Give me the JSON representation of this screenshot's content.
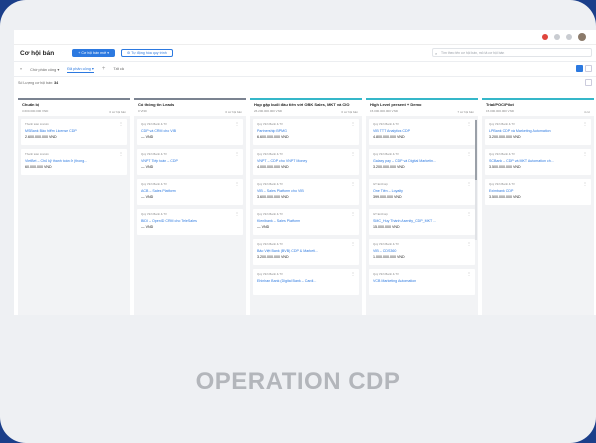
{
  "header": {
    "title": "Cơ hội bán",
    "add_button": "+ Cơ hội bán mới ▾",
    "auto_button": "Tự động hóa quy trình",
    "search_placeholder": "Tìm theo tên cơ hội bán, mô tả cơ hội bán"
  },
  "tabs": [
    {
      "label": "Chờ phân công ▾"
    },
    {
      "label": "Đã phân công ▾"
    },
    {
      "label": "Tất cả"
    }
  ],
  "count_label": "Số Lượng cơ hội bán:",
  "count_value": "34",
  "columns": [
    {
      "title": "Chuẩn bị",
      "sum": "3.600.000.000 VND",
      "count": "0 cơ hội bán",
      "color": "#7b8391",
      "cards": [
        {
          "company": "Thanh toán Lincoln",
          "name": "MSBank Bảo hiểm License CDP",
          "value": "2.600.000.000 VND"
        },
        {
          "company": "Thanh toán Lincoln",
          "name": "VietBet – Chủ kỹ thanh toán ở (thong...",
          "value": "60.000.000 VND"
        }
      ]
    },
    {
      "title": "Có thông tin Leads",
      "sum": "0 VND",
      "count": "0 cơ hội bán",
      "color": "#7b8391",
      "cards": [
        {
          "company": "Quý Vĩnh Banh & TV",
          "name": "CDP và CRM cho VIB",
          "value": "— VND"
        },
        {
          "company": "Quý Vĩnh Banh & TV",
          "name": "VNPT Tiếp toàn – CDP",
          "value": "— VND"
        },
        {
          "company": "Quý Vĩnh Banh & TV",
          "name": "ACB – Sales Platform",
          "value": "— VND"
        },
        {
          "company": "Quý Vĩnh Banh & TV",
          "name": "BIDI – OpenID CRM cho TeleSales",
          "value": "— VND"
        }
      ]
    },
    {
      "title": "Họp gặp buổi đầu tiên với OBK Sales, MKT và CIO",
      "sum": "26.200.000.000 VND",
      "count": "0 cơ hội bán",
      "color": "#35b7c9",
      "cards": [
        {
          "company": "Quý Vĩnh Banh & TV",
          "name": "Partnership BPMG",
          "value": "6.600.000.000 VND"
        },
        {
          "company": "Quý Vĩnh Banh & TV",
          "name": "VNPT – CDP cho VNPT Money",
          "value": "4.000.000.000 VND"
        },
        {
          "company": "Quý Vĩnh Banh & TV",
          "name": "VIB – Sales Platform cho VIB",
          "value": "3.600.000.000 VND"
        },
        {
          "company": "Quý Vĩnh Banh & TV",
          "name": "Kienlbank – Sales Platform",
          "value": "— VND"
        },
        {
          "company": "Quý Vĩnh Banh & TV",
          "name": "Bảo Việt Bank (BVB) CDP & Marketi...",
          "value": "3.200.000.000 VND"
        },
        {
          "company": "Quý Vĩnh Banh & TV",
          "name": "Ehinhan Bank (Digital Bank – Cardi...",
          "value": ""
        }
      ]
    },
    {
      "title": "High Level present + Demo",
      "sum": "15.000.000.000 VND",
      "count": "7 cơ hội bán",
      "color": "#35b7c9",
      "cards": [
        {
          "company": "Quý Vĩnh Banh & TV",
          "name": "VIB TTT Analytics CDP",
          "value": "4.800.000.000 VND"
        },
        {
          "company": "Quý Vĩnh Banh & TV",
          "name": "Galaxy pay – CDP và Digital Marketin...",
          "value": "3.200.000.000 VND"
        },
        {
          "company": "GT EntCorp",
          "name": "One Tiên – Loyalty",
          "value": "399.000.000 VND"
        },
        {
          "company": "GT EntCorp",
          "name": "SMC_Huy Thành Asenity_CDP_MKT ...",
          "value": "15.000.000 VND"
        },
        {
          "company": "Quý Vĩnh Banh & TV",
          "name": "VIB – CDS360",
          "value": "1.000.000.000 VND"
        },
        {
          "company": "Quý Vĩnh Banh & TV",
          "name": "VCB Marketing Automation",
          "value": ""
        }
      ]
    },
    {
      "title": "Trial/POC/Pilot",
      "sum": "15.000.000.000 VND",
      "count": "4 cơ",
      "color": "#35b7c9",
      "cards": [
        {
          "company": "Quý Vĩnh Banh & TV",
          "name": "LPBank CDP và Marketing Automation",
          "value": "3.200.000.000 VND"
        },
        {
          "company": "Quý Vĩnh Banh & TV",
          "name": "SCBank – CDP và MKT Automation ch...",
          "value": "3.500.000.000 VND"
        },
        {
          "company": "Quý Vĩnh Banh & TV",
          "name": "Eximbank CDP",
          "value": "3.500.000.000 VND"
        }
      ]
    }
  ],
  "caption": "OPERATION CDP"
}
